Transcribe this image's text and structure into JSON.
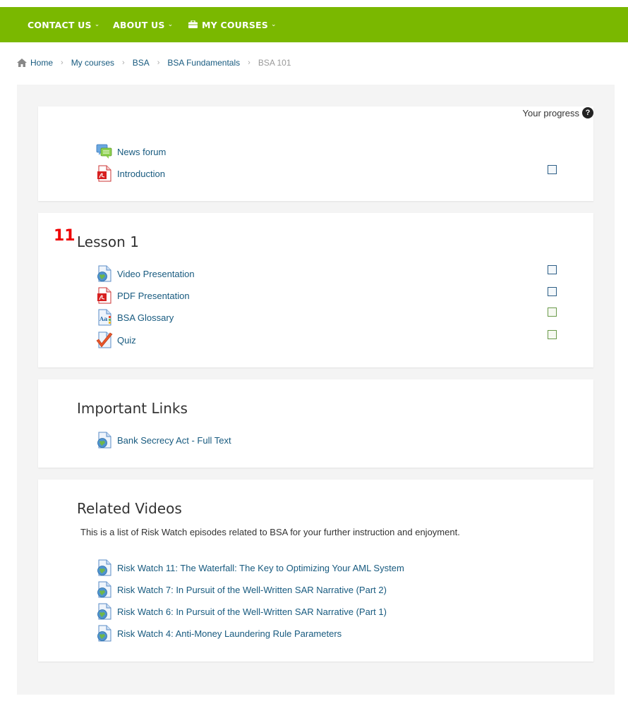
{
  "nav": {
    "contact_us": "CONTACT US",
    "about_us": "ABOUT US",
    "my_courses": "MY COURSES"
  },
  "breadcrumb": {
    "home": "Home",
    "my_courses": "My courses",
    "bsa": "BSA",
    "bsa_fundamentals": "BSA Fundamentals",
    "current": "BSA 101"
  },
  "progress": {
    "label": "Your progress",
    "help": "?"
  },
  "section0": {
    "activities": [
      {
        "label": "News forum",
        "icon": "forum-icon"
      },
      {
        "label": "Introduction",
        "icon": "pdf-icon"
      }
    ]
  },
  "section1": {
    "marker": "11",
    "title": "Lesson 1",
    "activities": [
      {
        "label": "Video Presentation",
        "icon": "url-globe-icon"
      },
      {
        "label": "PDF Presentation",
        "icon": "pdf-icon"
      },
      {
        "label": "BSA Glossary",
        "icon": "glossary-icon"
      },
      {
        "label": "Quiz",
        "icon": "quiz-icon"
      }
    ]
  },
  "section2": {
    "title": "Important Links",
    "activities": [
      {
        "label": "Bank Secrecy Act - Full Text",
        "icon": "url-globe-icon"
      }
    ]
  },
  "section3": {
    "title": "Related Videos",
    "summary": "This is a list of Risk Watch episodes related to BSA for your further instruction and enjoyment.",
    "activities": [
      {
        "label": "Risk Watch 11: The Waterfall: The Key to Optimizing Your AML System",
        "icon": "url-globe-icon"
      },
      {
        "label": "Risk Watch 7: In Pursuit of the Well-Written SAR Narrative (Part 2)",
        "icon": "url-globe-icon"
      },
      {
        "label": "Risk Watch 6: In Pursuit of the Well-Written SAR Narrative (Part 1)",
        "icon": "url-globe-icon"
      },
      {
        "label": "Risk Watch 4: Anti-Money Laundering Rule Parameters",
        "icon": "url-globe-icon"
      }
    ]
  },
  "colors": {
    "topbar": "#7ab800",
    "link": "#175a7f",
    "marker": "#ee0000"
  }
}
